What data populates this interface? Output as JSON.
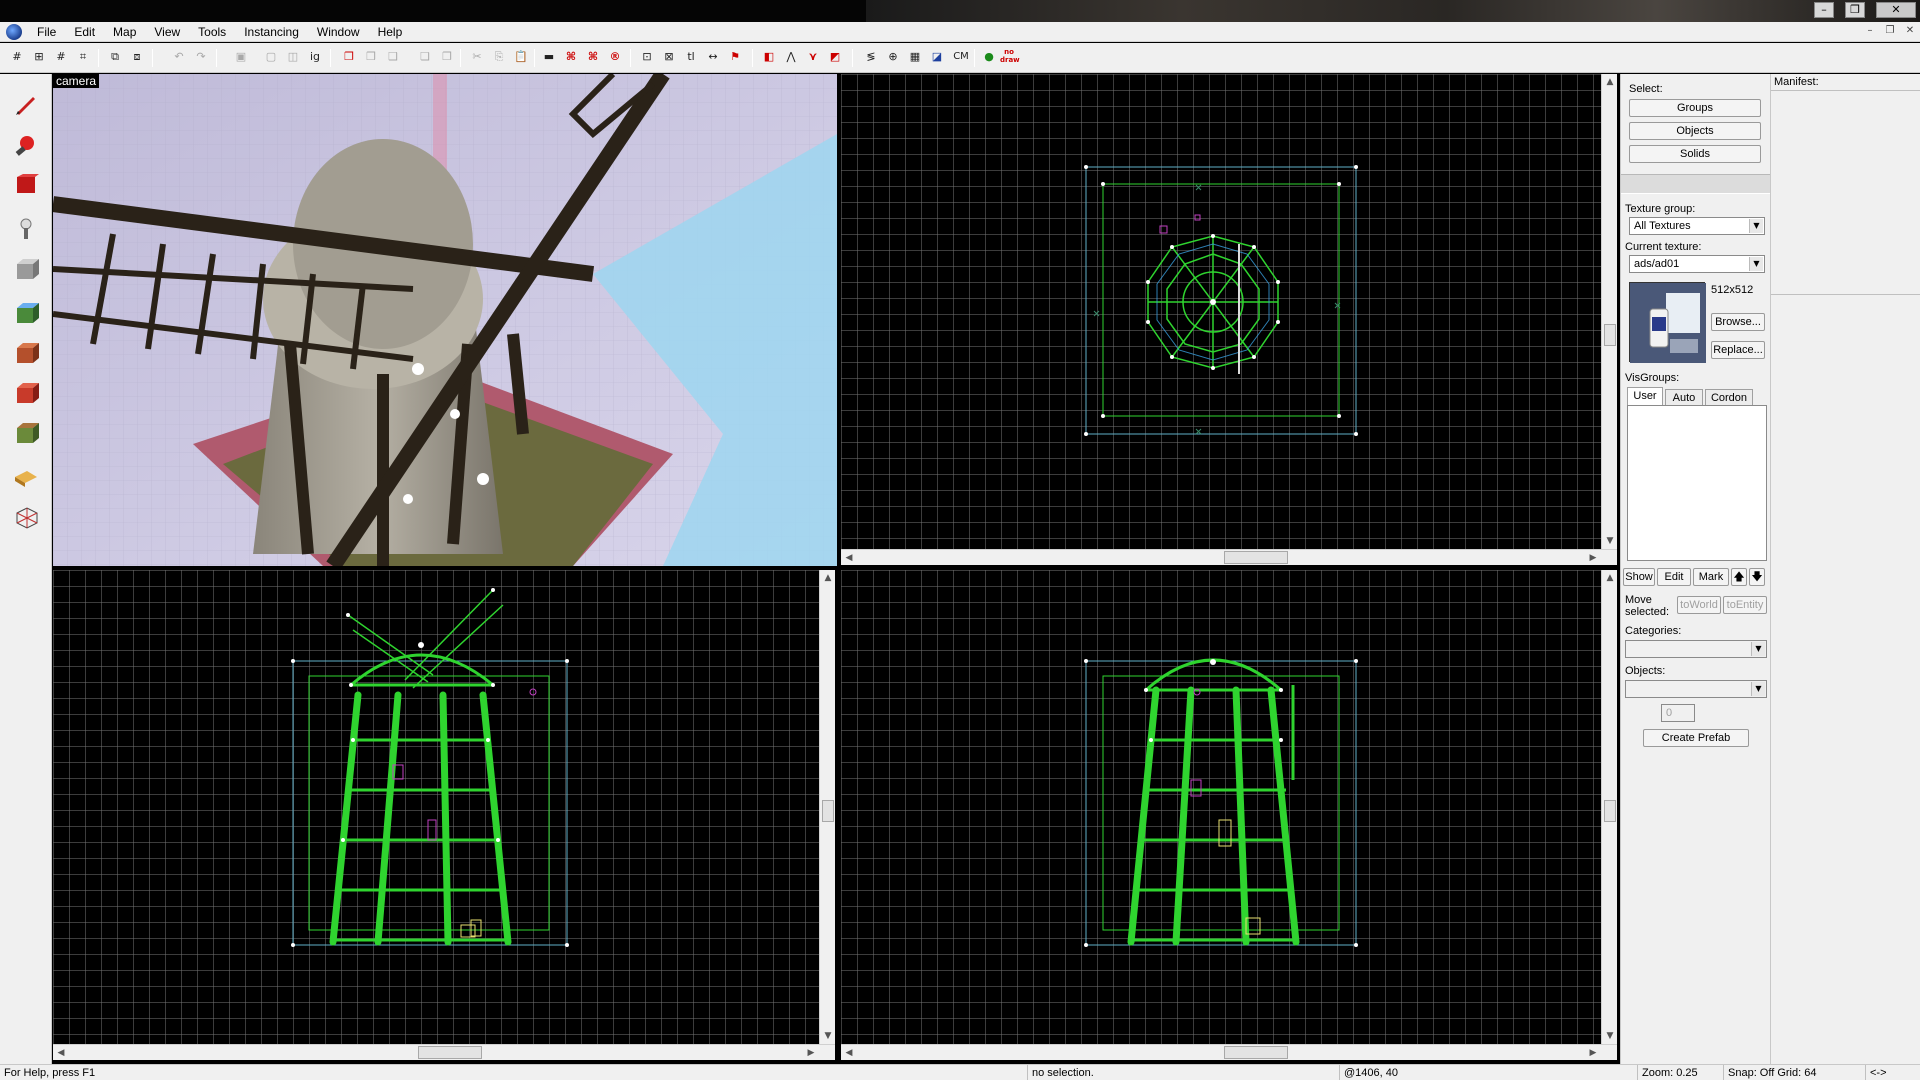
{
  "menu": {
    "items": [
      "File",
      "Edit",
      "Map",
      "View",
      "Tools",
      "Instancing",
      "Window",
      "Help"
    ]
  },
  "window_buttons": {
    "minimize": "–",
    "restore": "❐",
    "close": "✕"
  },
  "viewports": {
    "camera_label": "camera"
  },
  "toolbar_icons": [
    "grid",
    "grid-smaller",
    "grid-larger",
    "grid-toggle",
    "group",
    "ungroup",
    "undo",
    "redo",
    "carve",
    "cut",
    "copy",
    "paste",
    "texture-lock",
    "cordon",
    "hide",
    "quick-hide",
    "entity-report",
    "run-map",
    "cm",
    "no-draw"
  ],
  "toolbar_text": {
    "cm": "CM",
    "nodraw": "no draw"
  },
  "right_panel": {
    "select_label": "Select:",
    "groups": "Groups",
    "objects": "Objects",
    "solids": "Solids",
    "texture_group_label": "Texture group:",
    "texture_group_value": "All Textures",
    "current_texture_label": "Current texture:",
    "current_texture_value": "ads/ad01",
    "texture_size": "512x512",
    "browse": "Browse...",
    "replace": "Replace...",
    "visgroups_label": "VisGroups:",
    "tabs": [
      "User",
      "Auto",
      "Cordon"
    ],
    "show": "Show",
    "edit": "Edit",
    "mark": "Mark",
    "move_selected_label": "Move selected:",
    "to_world": "toWorld",
    "to_entity": "toEntity",
    "categories_label": "Categories:",
    "objects_label": "Objects:",
    "stepper_value": "0",
    "create_prefab": "Create Prefab"
  },
  "manifest": {
    "label": "Manifest:"
  },
  "status": {
    "help": "For Help, press F1",
    "selection": "no selection.",
    "coords": "@1406, 40",
    "zoom": "Zoom: 0.25",
    "snap": "Snap: Off Grid: 64",
    "arrows": "<->"
  },
  "colors": {
    "grid_line": "#6e6e6e",
    "wire_green": "#2fd42f",
    "wire_white": "#ffffff",
    "wire_magenta": "#c040c0",
    "bounds_cyan": "#5fb0c8",
    "ui_bg": "#f0f0f0"
  }
}
